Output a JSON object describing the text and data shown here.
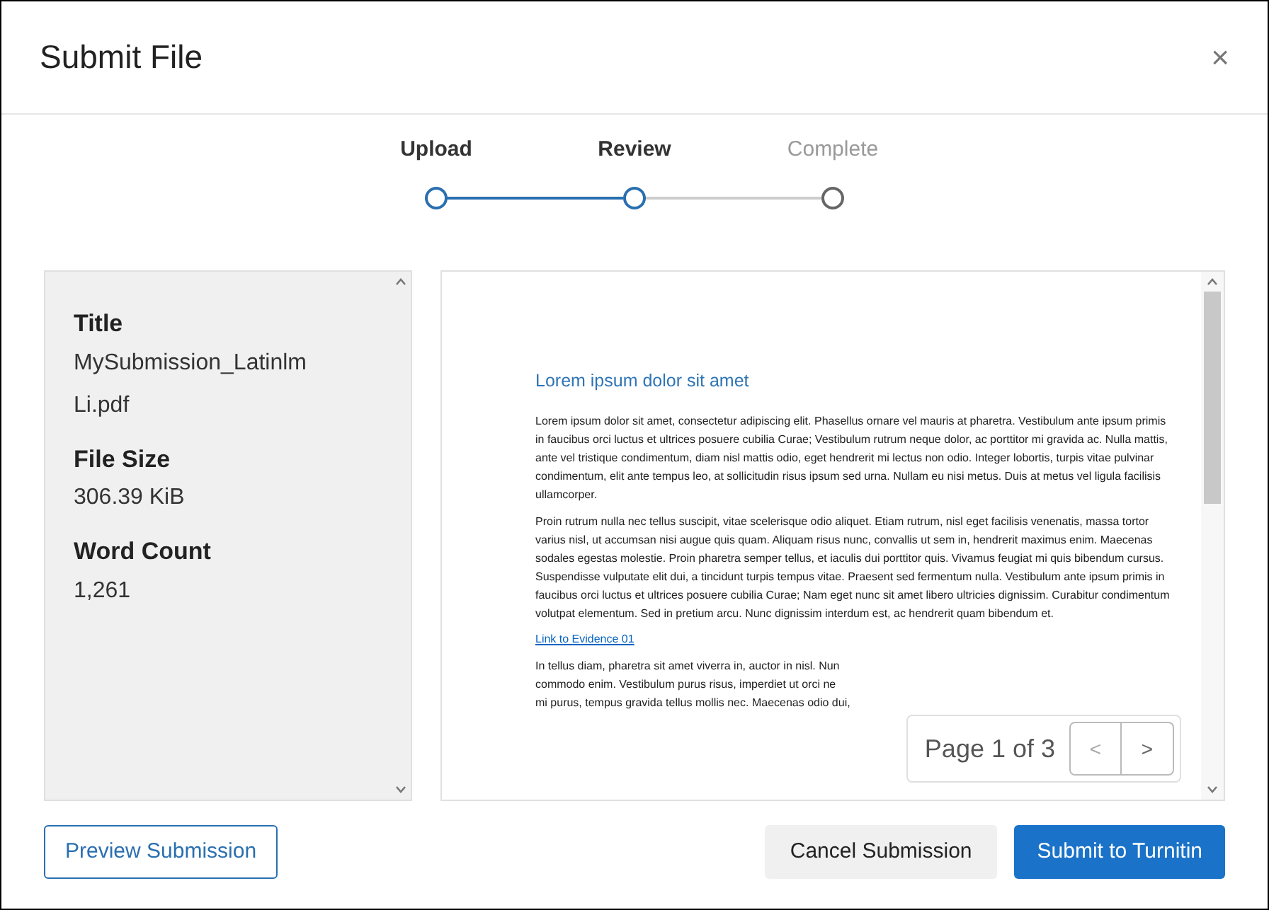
{
  "dialog": {
    "title": "Submit File",
    "close": "×"
  },
  "steps": [
    {
      "label": "Upload",
      "reached": true
    },
    {
      "label": "Review",
      "reached": true
    },
    {
      "label": "Complete",
      "reached": false
    }
  ],
  "details": [
    {
      "label": "Title",
      "value": "MySubmission_LatinlmLi.pdf"
    },
    {
      "label": "File Size",
      "value": "306.39 KiB"
    },
    {
      "label": "Word Count",
      "value": "1,261"
    }
  ],
  "document": {
    "heading": "Lorem ipsum dolor sit amet",
    "paragraphs": [
      "Lorem ipsum dolor sit amet, consectetur adipiscing elit. Phasellus ornare vel mauris at pharetra. Vestibulum ante ipsum primis in faucibus orci luctus et ultrices posuere cubilia Curae; Vestibulum rutrum neque dolor, ac porttitor mi gravida ac. Nulla mattis, ante vel tristique condimentum, diam nisl mattis odio, eget hendrerit mi lectus non odio. Integer lobortis, turpis vitae pulvinar condimentum, elit ante tempus leo, at sollicitudin risus ipsum sed urna. Nullam eu nisi metus. Duis at metus vel ligula facilisis ullamcorper.",
      "Proin rutrum nulla nec tellus suscipit, vitae scelerisque odio aliquet. Etiam rutrum, nisl eget facilisis venenatis, massa tortor varius nisl, ut accumsan nisi augue quis quam. Aliquam risus nunc, convallis ut sem in, hendrerit maximus enim. Maecenas sodales egestas molestie. Proin pharetra semper tellus, et iaculis dui porttitor quis. Vivamus feugiat mi quis bibendum cursus. Suspendisse vulputate elit dui, a tincidunt turpis tempus vitae. Praesent sed fermentum nulla. Vestibulum ante ipsum primis in faucibus orci luctus et ultrices posuere cubilia Curae; Nam eget nunc sit amet libero ultricies dignissim. Curabitur condimentum volutpat elementum. Sed in pretium arcu. Nunc dignissim interdum est, ac hendrerit quam bibendum et."
    ],
    "link": "Link to Evidence 01",
    "last_lines": [
      "In tellus diam, pharetra sit amet viverra in, auctor in nisl. Nun",
      "commodo enim. Vestibulum purus risus, imperdiet ut orci ne",
      "mi purus, tempus gravida tellus mollis nec. Maecenas odio dui,"
    ]
  },
  "pager": {
    "label": "Page 1 of 3",
    "prev": "<",
    "next": ">"
  },
  "footer": {
    "preview": "Preview Submission",
    "cancel": "Cancel Submission",
    "submit": "Submit to Turnitin"
  }
}
